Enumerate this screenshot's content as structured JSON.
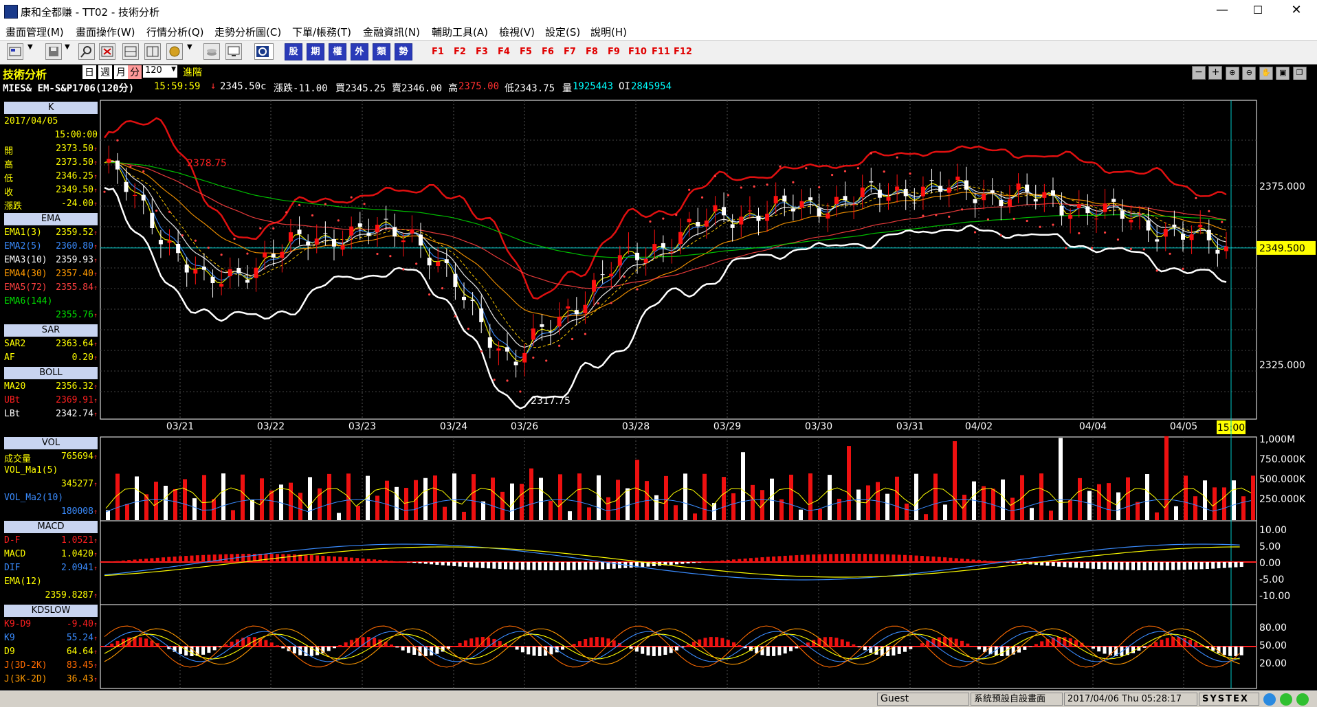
{
  "window": {
    "title": "康和全都賺 - TT02 - 技術分析",
    "minimize": "—",
    "maximize": "☐",
    "close": "✕"
  },
  "menu": [
    "畫面管理(M)",
    "畫面操作(W)",
    "行情分析(Q)",
    "走勢分析圖(C)",
    "下單/帳務(T)",
    "金融資訊(N)",
    "輔助工具(A)",
    "檢視(V)",
    "設定(S)",
    "說明(H)"
  ],
  "toolbar": {
    "red_buttons": [
      "股",
      "期",
      "權",
      "外",
      "類",
      "勢"
    ],
    "fkeys": [
      "F1",
      "F2",
      "F3",
      "F4",
      "F5",
      "F6",
      "F7",
      "F8",
      "F9",
      "F10",
      "F11",
      "F12"
    ]
  },
  "header": {
    "tech_title": "技術分析",
    "period_tabs": [
      "日",
      "週",
      "月",
      "分"
    ],
    "period_value": "120",
    "advanced": "進階",
    "symbol": "MIES& EM-S&P1706(120分)",
    "time": "15:59:59",
    "last": "2345.50c",
    "change": "漲跌-11.00",
    "bid": "買2345.25",
    "ask": "賣2346.00",
    "high_label": "高",
    "high": "2375.00",
    "low": "低2343.75",
    "vol_label": "量",
    "vol": "1925443",
    "oi_label": "OI",
    "oi": "2845954"
  },
  "left_panel": {
    "k_title": "K",
    "date": "2017/04/05",
    "time": "15:00:00",
    "ohlc": [
      {
        "label": "開",
        "value": "2373.50"
      },
      {
        "label": "高",
        "value": "2373.50"
      },
      {
        "label": "低",
        "value": "2346.25"
      },
      {
        "label": "收",
        "value": "2349.50"
      },
      {
        "label": "漲跌",
        "value": "-24.00"
      }
    ],
    "ema_title": "EMA",
    "ema": [
      {
        "label": "EMA1(3)",
        "value": "2359.52",
        "color": "#ffff00"
      },
      {
        "label": "EMA2(5)",
        "value": "2360.80",
        "color": "#3a8cff"
      },
      {
        "label": "EMA3(10)",
        "value": "2359.93",
        "color": "#ffffff"
      },
      {
        "label": "EMA4(30)",
        "value": "2357.40",
        "color": "#ff9900"
      },
      {
        "label": "EMA5(72)",
        "value": "2355.84",
        "color": "#ff4040"
      },
      {
        "label": "EMA6(144)",
        "value": "",
        "color": "#00e000"
      },
      {
        "label": "",
        "value": "2355.76",
        "color": "#00e000"
      }
    ],
    "sar_title": "SAR",
    "sar": [
      {
        "label": "SAR2",
        "value": "2363.64"
      },
      {
        "label": "AF",
        "value": "0.20"
      }
    ],
    "boll_title": "BOLL",
    "boll": [
      {
        "label": "MA20",
        "value": "2356.32",
        "color": "#ffff00"
      },
      {
        "label": "UBt",
        "value": "2369.91",
        "color": "#ff2020"
      },
      {
        "label": "LBt",
        "value": "2342.74",
        "color": "#ffffff"
      }
    ],
    "vol_title": "VOL",
    "vol": [
      {
        "label": "成交量",
        "value": "765694",
        "color": "#ffff00"
      },
      {
        "label": "VOL_Ma1(5)",
        "value": "",
        "color": "#ffff00"
      },
      {
        "label": "",
        "value": "345277",
        "color": "#ffff00"
      },
      {
        "label": "VOL_Ma2(10)",
        "value": "",
        "color": "#3a8cff"
      },
      {
        "label": "",
        "value": "180008",
        "color": "#3a8cff"
      }
    ],
    "macd_title": "MACD",
    "macd": [
      {
        "label": "D-F",
        "value": "1.0521",
        "color": "#ff2020"
      },
      {
        "label": "MACD",
        "value": "1.0420",
        "color": "#ffff00"
      },
      {
        "label": "DIF",
        "value": "2.0941",
        "color": "#3a8cff"
      },
      {
        "label": "EMA(12)",
        "value": "",
        "color": "#ffff00"
      },
      {
        "label": "",
        "value": "2359.8287",
        "color": "#ffff00"
      }
    ],
    "kd_title": "KDSLOW",
    "kd": [
      {
        "label": "K9-D9",
        "value": "-9.40",
        "color": "#ff2020"
      },
      {
        "label": "K9",
        "value": "55.24",
        "color": "#3a8cff"
      },
      {
        "label": "D9",
        "value": "64.64",
        "color": "#ffff00"
      },
      {
        "label": "J(3D-2K)",
        "value": "83.45",
        "color": "#ff6a00"
      },
      {
        "label": "J(3K-2D)",
        "value": "36.43",
        "color": "#ff9900"
      }
    ]
  },
  "chart": {
    "xlabels": [
      "03/21",
      "03/22",
      "03/23",
      "03/24",
      "03/26",
      "03/28",
      "03/29",
      "03/30",
      "03/31",
      "04/02",
      "04/04",
      "04/05"
    ],
    "cursor_time": "15:00",
    "yaxis_main": [
      "2375.000",
      "2325.000"
    ],
    "price_tag": "2349.500",
    "hi_label": "2378.75",
    "lo_label": "2317.75",
    "yaxis_vol": [
      "1,000M",
      "750.000K",
      "500.000K",
      "250.000K"
    ],
    "yaxis_macd": [
      "10.00",
      "5.00",
      "0.00",
      "-5.00",
      "-10.00"
    ],
    "yaxis_kd": [
      "80.00",
      "50.00",
      "20.00"
    ]
  },
  "status": {
    "user": "Guest",
    "layout": "系統預設自設畫面",
    "datetime": "2017/04/06 Thu 05:28:17",
    "brand": "SYSTEX"
  },
  "chart_data": {
    "type": "candlestick",
    "title": "MIES& EM-S&P1706(120分)",
    "categories": [
      "03/21",
      "03/22",
      "03/23",
      "03/24",
      "03/26",
      "03/28",
      "03/29",
      "03/30",
      "03/31",
      "04/02",
      "04/04",
      "04/05"
    ],
    "ylim": [
      2310,
      2385
    ],
    "close_approx": [
      2370,
      2340,
      2352,
      2354,
      2322,
      2345,
      2357,
      2360,
      2364,
      2362,
      2357,
      2349.5
    ],
    "high": 2378.75,
    "low": 2317.75,
    "last_close": 2349.5
  }
}
